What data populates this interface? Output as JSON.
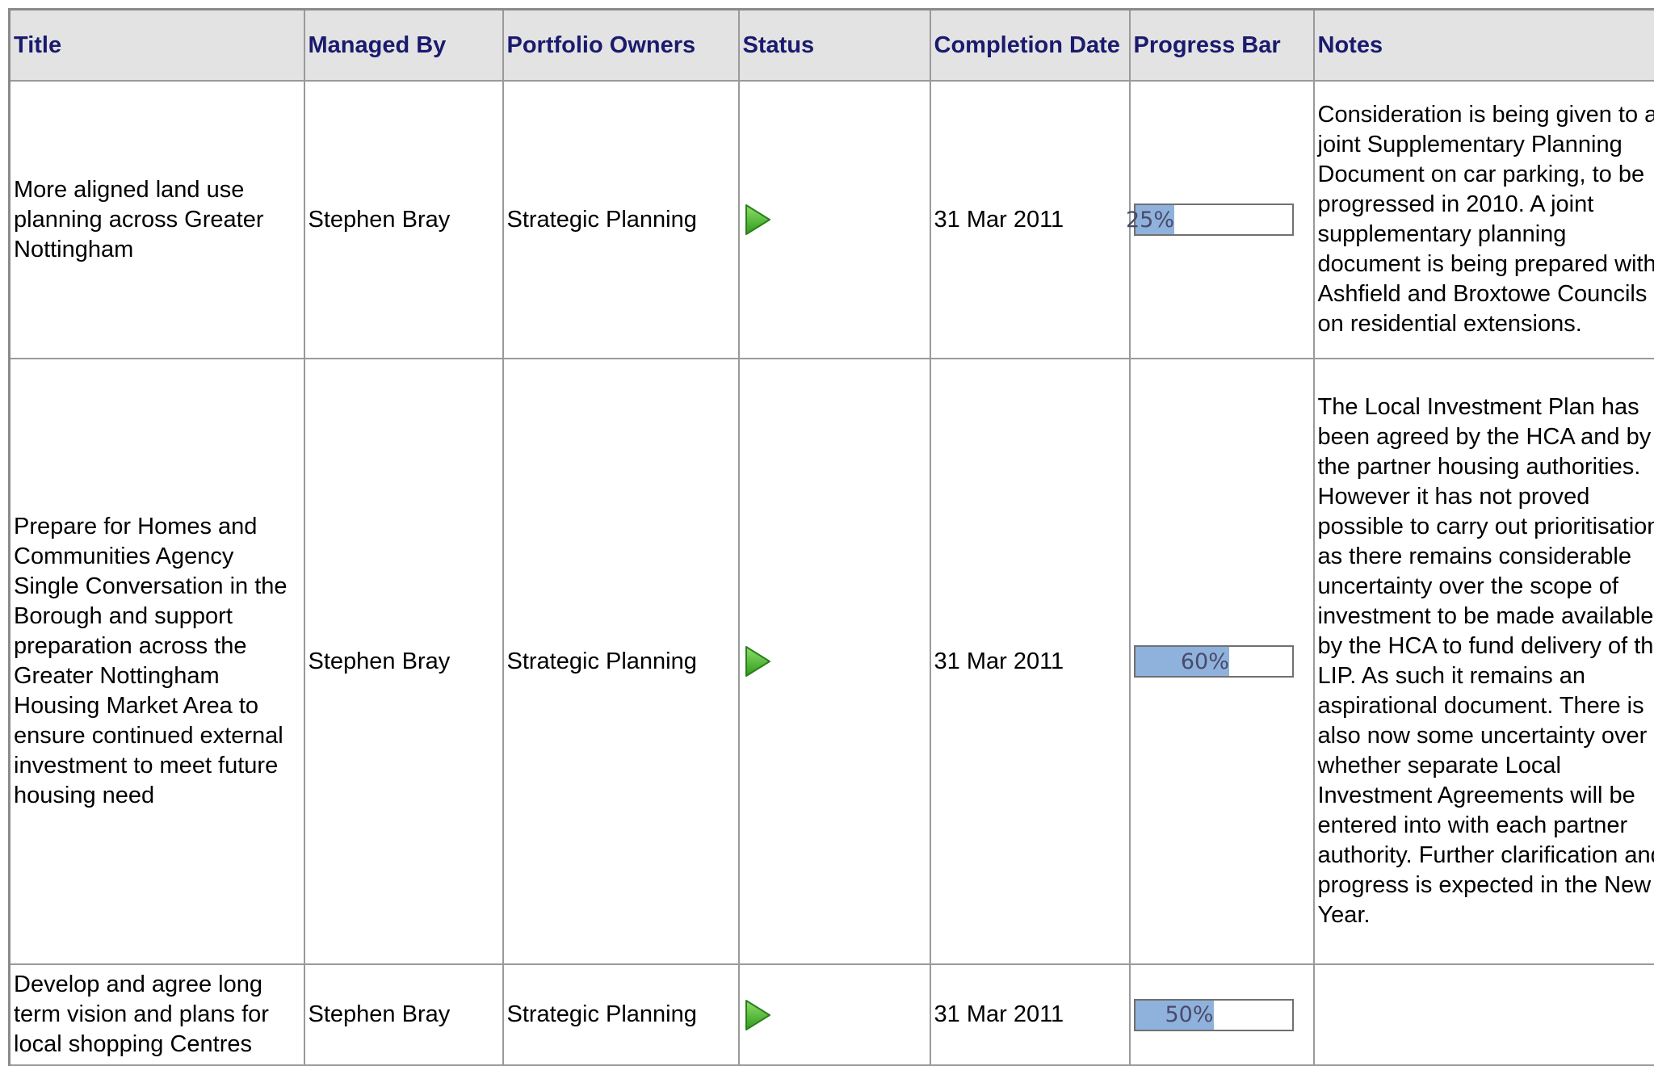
{
  "table": {
    "headers": {
      "title": "Title",
      "managed_by": "Managed By",
      "portfolio_owners": "Portfolio Owners",
      "status": "Status",
      "completion_date": "Completion Date",
      "progress_bar": "Progress Bar",
      "notes": "Notes"
    },
    "rows": [
      {
        "title": "More aligned land use planning across Greater Nottingham",
        "managed_by": "Stephen Bray",
        "portfolio_owners": "Strategic Planning",
        "status_icon": "green-play-icon",
        "completion_date": "31 Mar 2011",
        "progress": 0.25,
        "progress_label": "25%",
        "notes": "Consideration is being given to a joint Supplementary Planning Document on car parking, to be progressed in 2010. A joint supplementary planning document is being prepared with Ashfield and Broxtowe Councils on residential extensions."
      },
      {
        "title": "Prepare for Homes and Communities Agency Single Conversation in the Borough and support preparation across the Greater Nottingham Housing Market Area to ensure continued external investment to meet future housing need",
        "managed_by": "Stephen Bray",
        "portfolio_owners": "Strategic Planning",
        "status_icon": "green-play-icon",
        "completion_date": "31 Mar 2011",
        "progress": 0.6,
        "progress_label": "60%",
        "notes": "The Local Investment Plan has been agreed by the HCA and by the partner housing authorities. However it has not proved possible to carry out prioritisation as there remains considerable uncertainty over the scope of investment to be made available by the HCA to fund delivery of the LIP. As such it remains an aspirational document. There is also now some uncertainty over whether separate Local Investment Agreements will be entered into with each partner authority. Further clarification and progress is expected in the New Year."
      },
      {
        "title": "Develop and agree long term vision and plans for local shopping Centres",
        "managed_by": "Stephen Bray",
        "portfolio_owners": "Strategic Planning",
        "status_icon": "green-play-icon",
        "completion_date": "31 Mar 2011",
        "progress": 0.5,
        "progress_label": "50%",
        "notes": ""
      }
    ],
    "colors": {
      "header_bg": "#e3e3e3",
      "header_text": "#1a1a6e",
      "progress_fill": "#8fb2dd",
      "status_green": "#4cb82e"
    }
  }
}
